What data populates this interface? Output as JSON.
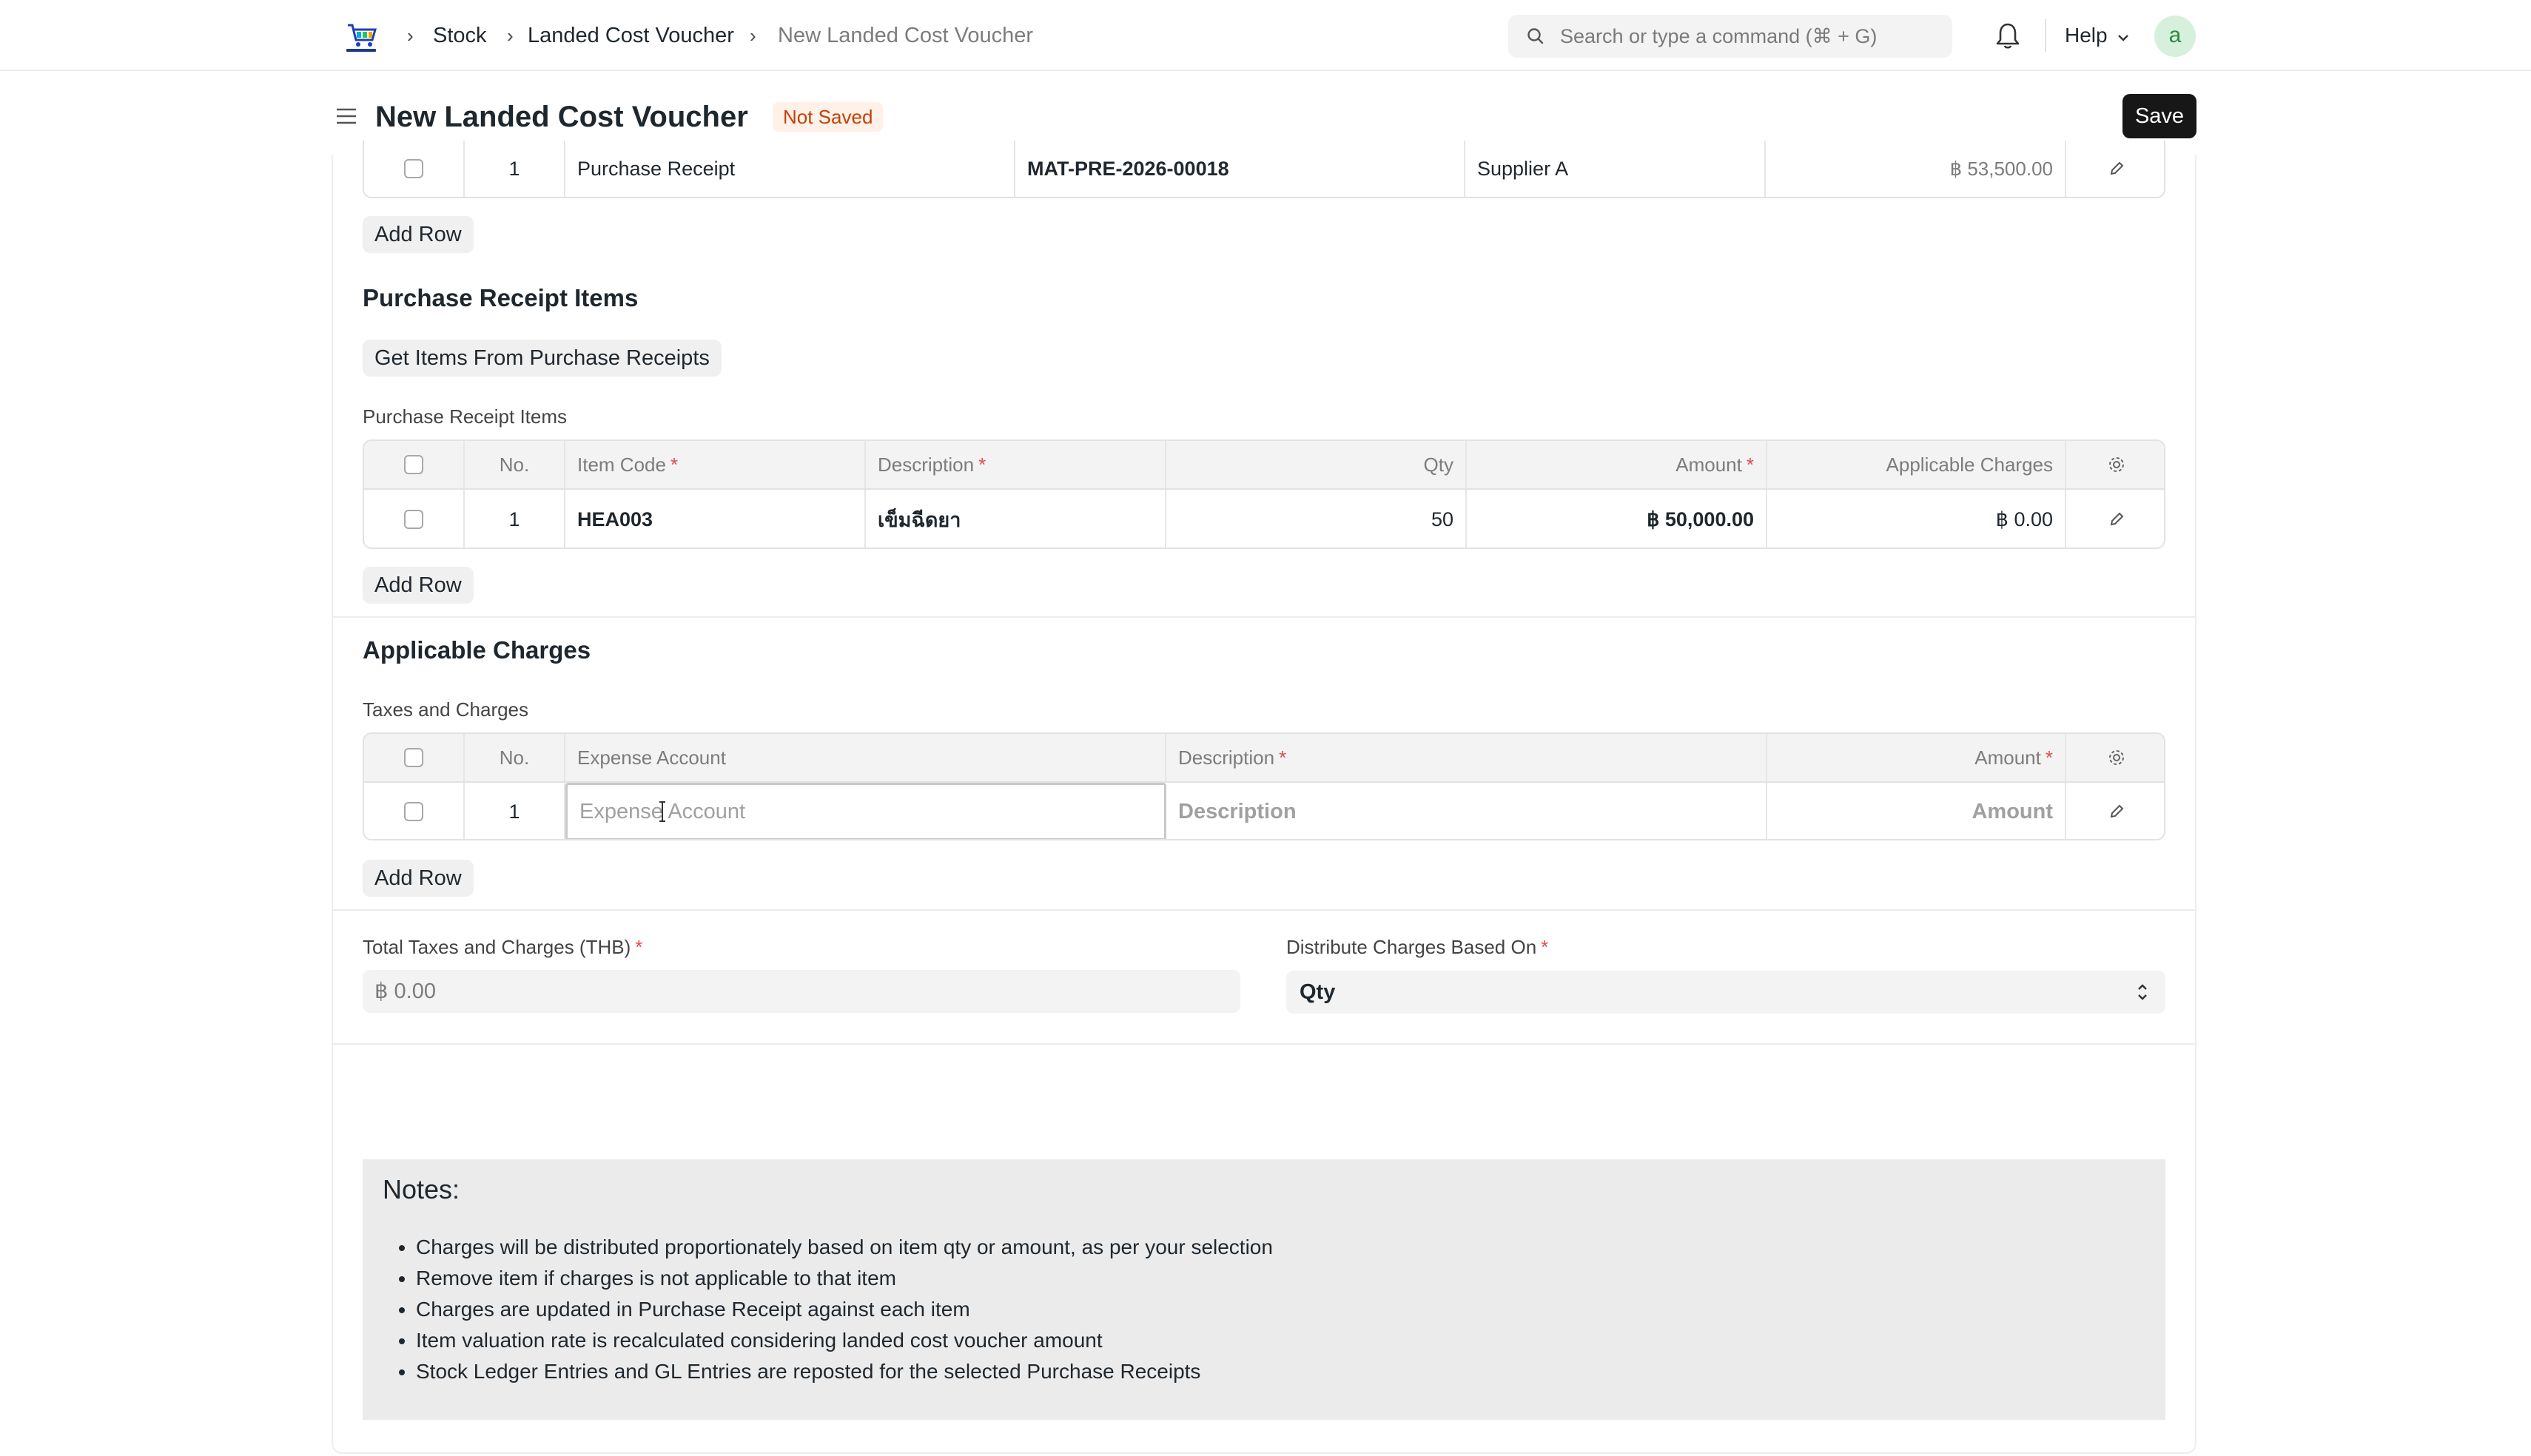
{
  "navbar": {
    "breadcrumbs": [
      "Stock",
      "Landed Cost Voucher",
      "New Landed Cost Voucher"
    ],
    "search_placeholder": "Search or type a command (⌘ + G)",
    "help_label": "Help",
    "avatar_initial": "a"
  },
  "page": {
    "title": "New Landed Cost Voucher",
    "status": "Not Saved",
    "save_label": "Save"
  },
  "receipts_table": {
    "rows": [
      {
        "no": "1",
        "doc_type": "Purchase Receipt",
        "receipt": "MAT-PRE-2026-00018",
        "supplier": "Supplier A",
        "grand_total": "฿ 53,500.00"
      }
    ],
    "add_row_label": "Add Row"
  },
  "items_section": {
    "title": "Purchase Receipt Items",
    "get_items_label": "Get Items From Purchase Receipts",
    "table_label": "Purchase Receipt Items",
    "columns": {
      "no": "No.",
      "item_code": "Item Code",
      "description": "Description",
      "qty": "Qty",
      "amount": "Amount",
      "charges": "Applicable Charges"
    },
    "rows": [
      {
        "no": "1",
        "item_code": "HEA003",
        "description": "เข็มฉีดยา",
        "qty": "50",
        "amount": "฿ 50,000.00",
        "charges": "฿ 0.00"
      }
    ],
    "add_row_label": "Add Row"
  },
  "charges_section": {
    "title": "Applicable Charges",
    "table_label": "Taxes and Charges",
    "columns": {
      "no": "No.",
      "expense_account": "Expense Account",
      "description": "Description",
      "amount": "Amount"
    },
    "rows": [
      {
        "no": "1",
        "expense_account_placeholder": "Expense Account",
        "description_placeholder": "Description",
        "amount_placeholder": "Amount"
      }
    ],
    "add_row_label": "Add Row"
  },
  "totals": {
    "total_label": "Total Taxes and Charges (THB)",
    "total_value": "฿ 0.00",
    "distribute_label": "Distribute Charges Based On",
    "distribute_value": "Qty"
  },
  "notes": {
    "title": "Notes:",
    "items": [
      "Charges will be distributed proportionately based on item qty or amount, as per your selection",
      "Remove item if charges is not applicable to that item",
      "Charges are updated in Purchase Receipt against each item",
      "Item valuation rate is recalculated considering landed cost voucher amount",
      "Stock Ledger Entries and GL Entries are reposted for the selected Purchase Receipts"
    ]
  },
  "colors": {
    "save_bg": "#171717",
    "badge_bg": "#fff1e7",
    "badge_text": "#c2410c",
    "required": "#e24c4c"
  }
}
